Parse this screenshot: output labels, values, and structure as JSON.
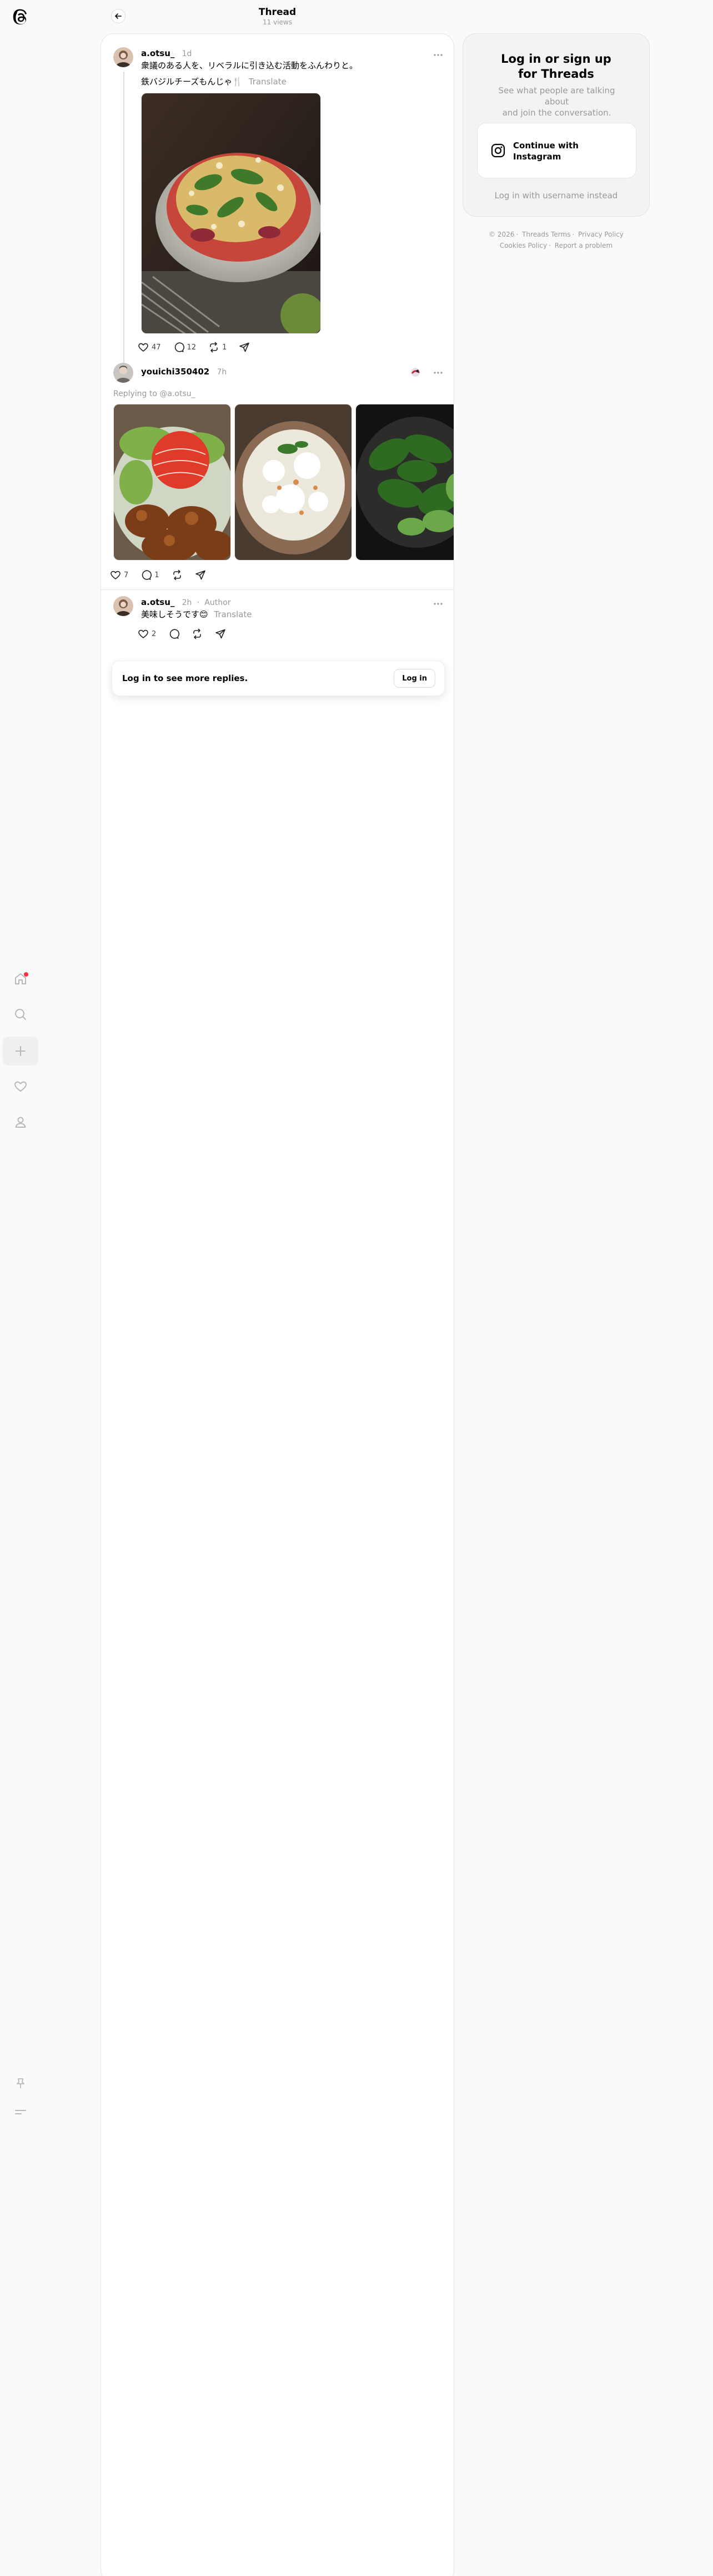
{
  "header": {
    "title": "Thread",
    "views": "11 views"
  },
  "nav": {
    "icons": [
      "threads-logo-icon",
      "home-icon",
      "search-icon",
      "create-icon",
      "heart-icon",
      "profile-icon",
      "pin-icon",
      "menu-icon"
    ]
  },
  "posts": [
    {
      "username": "a.otsu_",
      "time": "1d",
      "line1": "衆議のある人を、リベラルに引き込む活動をふんわりと。",
      "line2": "鉄バジルチーズもんじゃ🍴",
      "translate": "Translate",
      "stats": {
        "likes": "47",
        "replies": "12",
        "reposts": "1"
      }
    },
    {
      "username": "youichi350402",
      "time": "7h",
      "replying": "Replying to @a.otsu_",
      "stats": {
        "likes": "7",
        "replies": "1"
      }
    },
    {
      "username": "a.otsu_",
      "time": "2h",
      "author": "Author",
      "line1": "美味しそうです😊",
      "translate": "Translate",
      "stats": {
        "likes": "2"
      }
    }
  ],
  "login_prompt": {
    "text": "Log in to see more replies.",
    "button": "Log in"
  },
  "side": {
    "title_line1": "Log in or sign up",
    "title_line2": "for Threads",
    "subtitle_line1": "See what people are talking about",
    "subtitle_line2": "and join the conversation.",
    "instagram_line1": "Continue with",
    "instagram_line2": "Instagram",
    "username_login": "Log in with username instead"
  },
  "footer": {
    "copyright": "© 2026",
    "terms": "Threads Terms",
    "privacy": "Privacy Policy",
    "cookies": "Cookies Policy",
    "report": "Report a problem"
  },
  "colors": {
    "accent_red": "#ff3040",
    "muted": "#999999",
    "background": "#fafafa"
  }
}
